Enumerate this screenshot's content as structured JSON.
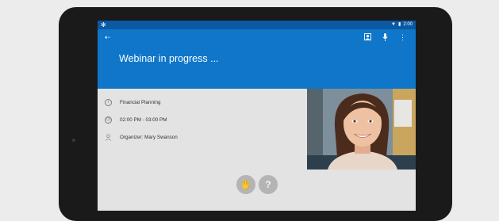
{
  "status_bar": {
    "left_icon": "snowflake-icon",
    "time": "2:00"
  },
  "app_bar": {
    "title": "Webinar in progress ...",
    "back_icon": "exit-icon",
    "actions": [
      "participants-icon",
      "microphone-icon",
      "more-vert-icon"
    ]
  },
  "meeting": {
    "subject": "Financial Planning",
    "time": "02:00 PM - 03:00 PM",
    "organizer": "Organizer: Mary Swanson"
  },
  "controls": [
    {
      "icon": "raise-hand-icon",
      "glyph": "✋"
    },
    {
      "icon": "help-icon",
      "glyph": "?"
    }
  ],
  "colors": {
    "app_bar": "#0f76c9",
    "status_bar": "#0b58a3",
    "background": "#e3e3e3"
  }
}
